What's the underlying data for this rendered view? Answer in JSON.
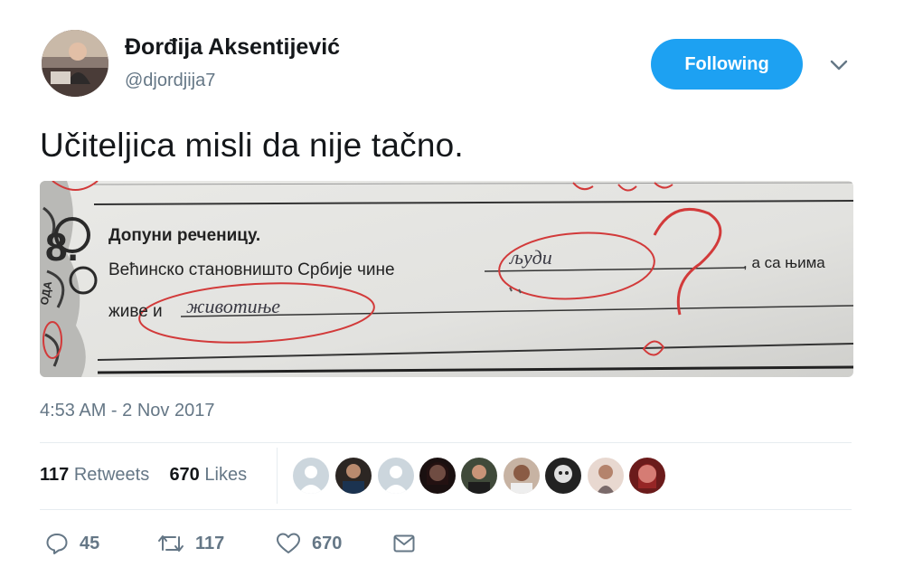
{
  "author": {
    "display_name": "Đorđija Aksentijević",
    "handle": "@djordjija7"
  },
  "follow_button": {
    "label": "Following"
  },
  "tweet": {
    "text": "Učiteljica misli da nije tačno.",
    "timestamp": "4:53 AM - 2 Nov 2017"
  },
  "photo": {
    "heading": "Допуни реченицу.",
    "line1_prefix": "Већинско становништо Србије чине",
    "line1_answer": "људи",
    "line1_suffix": ", а са њима",
    "line2_prefix": "живе и",
    "line2_answer": "животиње",
    "exercise_number": "8.",
    "side_text": "ОДА"
  },
  "stats": {
    "retweets_count": "117",
    "retweets_label": "Retweets",
    "likes_count": "670",
    "likes_label": "Likes"
  },
  "actions": {
    "reply_count": "45",
    "retweet_count": "117",
    "like_count": "670"
  },
  "colors": {
    "accent": "#1da1f2",
    "secondary_text": "#657786",
    "primary_text": "#14171a",
    "divider": "#e6ecf0",
    "teacher_ink": "#d23a3a"
  },
  "icons": [
    "chevron-down-icon",
    "reply-icon",
    "retweet-icon",
    "heart-icon",
    "message-icon"
  ]
}
